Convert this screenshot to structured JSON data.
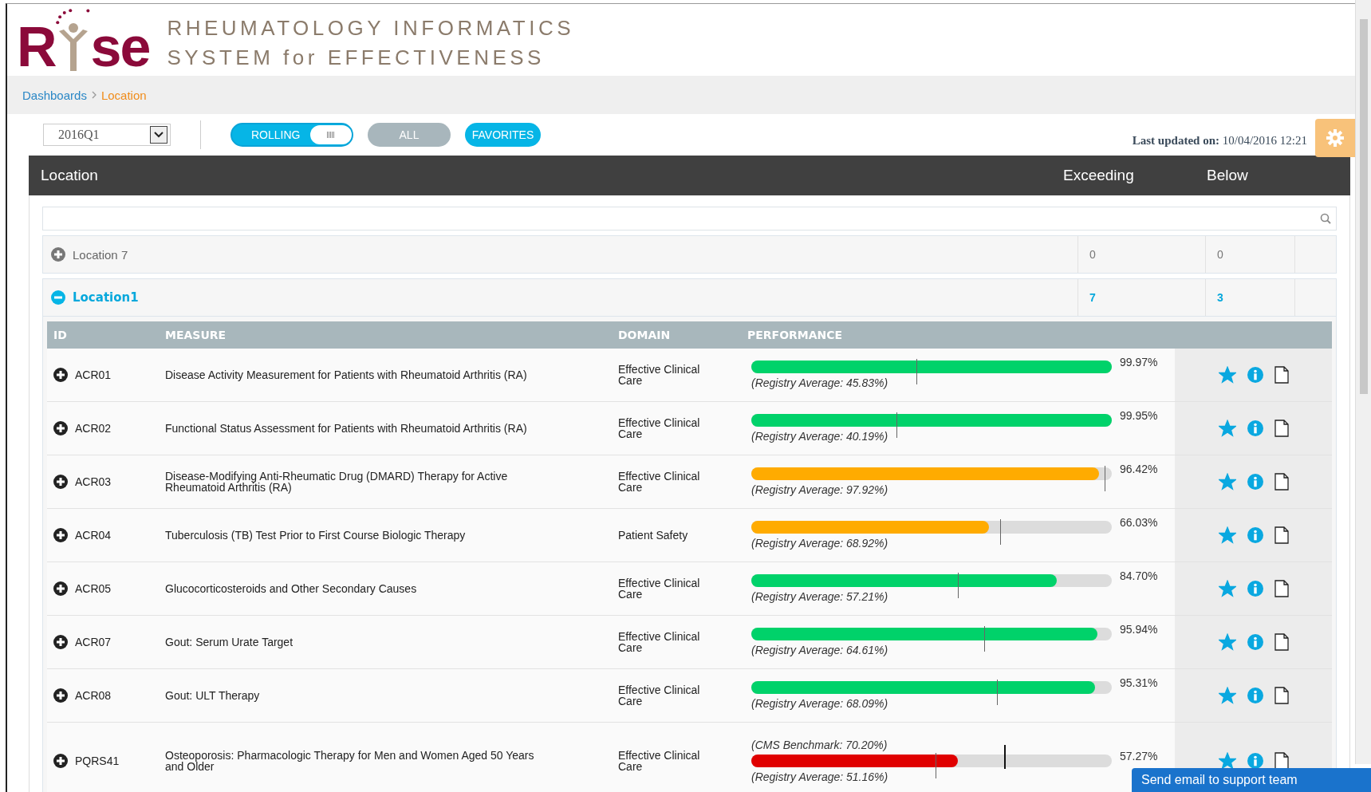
{
  "logo": {
    "text_before": "R",
    "text_after": "se"
  },
  "header": {
    "title_lines": [
      "RHEUMATOLOGY INFORMATICS",
      "SYSTEM for EFFECTIVENESS"
    ]
  },
  "breadcrumb": [
    {
      "label": "Dashboards",
      "current": false
    },
    {
      "label": "Location",
      "current": true
    }
  ],
  "toolbar": {
    "period": "2016Q1",
    "rolling": {
      "label": "ROLLING",
      "on": true
    },
    "filters": [
      {
        "label": "ALL",
        "selected": false
      },
      {
        "label": "FAVORITES",
        "selected": true
      }
    ],
    "last_updated": {
      "label": "Last updated on:",
      "value": "10/04/2016 12:21"
    }
  },
  "panel": {
    "title": "Location",
    "columns": [
      "Exceeding",
      "Below"
    ]
  },
  "locations": [
    {
      "name": "Location 7",
      "expanded": false,
      "exceeding": "0",
      "below": "0"
    },
    {
      "name": "Location1",
      "expanded": true,
      "exceeding": "7",
      "below": "3",
      "table": {
        "columns": [
          "ID",
          "MEASURE",
          "DOMAIN",
          "PERFORMANCE"
        ],
        "rows": [
          {
            "id": "ACR01",
            "measure": "Disease Activity Measurement for Patients with Rheumatoid Arthritis (RA)",
            "domain": "Effective Clinical Care",
            "level": 0.9997,
            "color": "#00d26a",
            "percent": "99.97%",
            "registry": "(Registry Average: 45.83%)",
            "marker": {
              "level": 0.4583
            },
            "expanded": false,
            "favorite": true
          },
          {
            "id": "ACR02",
            "measure": "Functional Status Assessment for Patients with Rheumatoid Arthritis (RA)",
            "domain": "Effective Clinical Care",
            "level": 0.9995,
            "color": "#00d26a",
            "percent": "99.95%",
            "registry": "(Registry Average: 40.19%)",
            "marker": {
              "level": 0.4019
            },
            "expanded": false,
            "favorite": true
          },
          {
            "id": "ACR03",
            "measure": "Disease-Modifying Anti-Rheumatic Drug (DMARD) Therapy for Active Rheumatoid Arthritis (RA)",
            "domain": "Effective Clinical Care",
            "level": 0.9642,
            "color": "#ffab00",
            "percent": "96.42%",
            "registry": "(Registry Average: 97.92%)",
            "marker": {
              "level": 0.9792
            },
            "expanded": false,
            "favorite": true
          },
          {
            "id": "ACR04",
            "measure": "Tuberculosis (TB) Test Prior to First Course Biologic Therapy",
            "domain": "Patient Safety",
            "level": 0.6603,
            "color": "#ffab00",
            "percent": "66.03%",
            "registry": "(Registry Average: 68.92%)",
            "marker": {
              "level": 0.6892
            },
            "expanded": false,
            "favorite": true
          },
          {
            "id": "ACR05",
            "measure": "Glucocorticosteroids and Other Secondary Causes",
            "domain": "Effective Clinical Care",
            "level": 0.847,
            "color": "#00d26a",
            "percent": "84.70%",
            "registry": "(Registry Average: 57.21%)",
            "marker": {
              "level": 0.5721
            },
            "expanded": false,
            "favorite": true
          },
          {
            "id": "ACR07",
            "measure": "Gout: Serum Urate Target",
            "domain": "Effective Clinical Care",
            "level": 0.9594,
            "color": "#00d26a",
            "percent": "95.94%",
            "registry": "(Registry Average: 64.61%)",
            "marker": {
              "level": 0.6461
            },
            "expanded": false,
            "favorite": true
          },
          {
            "id": "ACR08",
            "measure": "Gout: ULT Therapy",
            "domain": "Effective Clinical Care",
            "level": 0.9531,
            "color": "#00d26a",
            "percent": "95.31%",
            "registry": "(Registry Average: 68.09%)",
            "marker": {
              "level": 0.6809
            },
            "expanded": false,
            "favorite": true
          },
          {
            "id": "PQRS41",
            "measure": "Osteoporosis: Pharmacologic Therapy for Men and Women Aged 50 Years and Older",
            "domain": "Effective Clinical Care",
            "level": 0.5727,
            "color": "#e00000",
            "percent": "57.27%",
            "registry": "(Registry Average: 51.16%)",
            "marker": {
              "level": 0.5116
            },
            "benchmark": {
              "label": "(CMS Benchmark: 70.20%)",
              "level": 0.702
            },
            "expanded": false,
            "favorite": true
          }
        ]
      }
    }
  ],
  "support_button": "Send email to support team"
}
